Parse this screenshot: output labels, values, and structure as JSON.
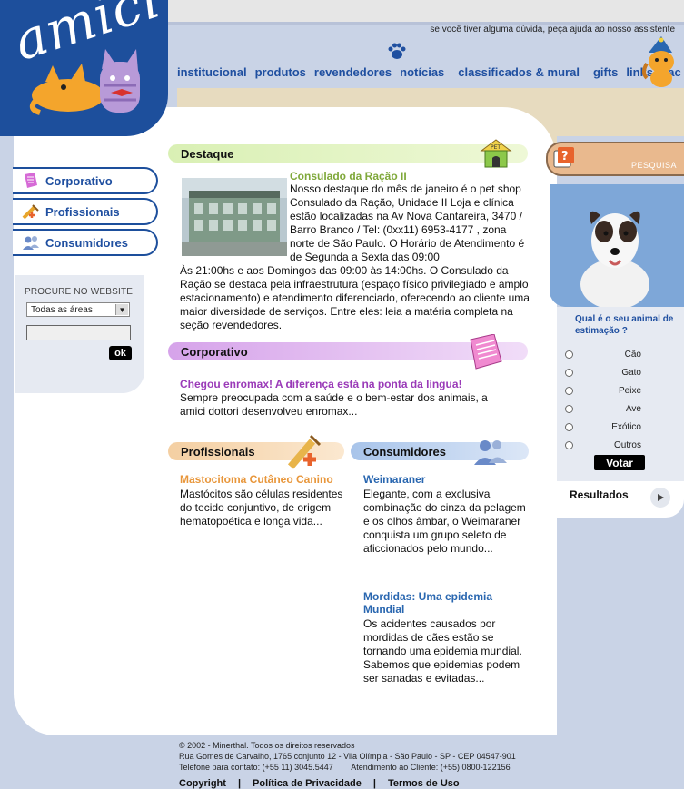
{
  "brand": {
    "logo": "amici"
  },
  "header": {
    "help_text": "se você tiver alguma dúvida, peça ajuda ao nosso assistente",
    "nav": [
      "institucional",
      "produtos",
      "revendedores",
      "notícias",
      "classificados & mural",
      "gifts",
      "links",
      "sac"
    ]
  },
  "sidebar": {
    "items": [
      {
        "label": "Corporativo",
        "icon": "document-icon"
      },
      {
        "label": "Profissionais",
        "icon": "syringe-icon"
      },
      {
        "label": "Consumidores",
        "icon": "people-icon"
      }
    ],
    "search_label": "PROCURE NO WEBSITE",
    "search_select": "Todas as áreas",
    "search_value": "",
    "ok_label": "ok"
  },
  "destaque": {
    "header": "Destaque",
    "title": "Consulado da Ração II",
    "text1": "Nosso destaque do mês de janeiro é o pet shop Consulado da Ração, Unidade II Loja e clínica estão localizadas na Av Nova Cantareira, 3470 / Barro Branco / Tel: (0xx11) 6953-4177 , zona norte de São Paulo. O Horário de Atendimento é de Segunda a Sexta das 09:00",
    "text2": "Às 21:00hs e aos Domingos das 09:00 às 14:00hs. O Consulado da Ração se destaca pela infraestrutura (espaço físico privilegiado e amplo estacionamento) e atendimento diferenciado, oferecendo ao cliente uma maior diversidade de serviços. Entre eles: leia a matéria completa na seção revendedores."
  },
  "corporativo": {
    "header": "Corporativo",
    "title": "Chegou enromax! A diferença está na ponta da língua!",
    "text": "Sempre preocupada com a saúde e o bem-estar dos animais, a amici dottori desenvolveu enromax..."
  },
  "profissionais": {
    "header": "Profissionais",
    "title": "Mastocitoma Cutâneo Canino",
    "text": "Mastócitos são células residentes do tecido conjuntivo, de origem hematopoética e longa vida..."
  },
  "consumidores": {
    "header": "Consumidores",
    "articles": [
      {
        "title": "Weimaraner",
        "text": "Elegante, com a exclusiva combinação do cinza da pelagem e os olhos âmbar, o Weimaraner conquista um grupo seleto de aficcionados pelo mundo..."
      },
      {
        "title": "Mordidas: Uma epidemia Mundial",
        "text": "Os acidentes causados por mordidas de cães estão se tornando uma epidemia mundial. Sabemos que epidemias podem ser sanadas e evitadas..."
      }
    ]
  },
  "pesquisa": {
    "label": "PESQUISA",
    "question": "Qual é o seu animal de estimação ?",
    "options": [
      "Cão",
      "Gato",
      "Peixe",
      "Ave",
      "Exótico",
      "Outros"
    ],
    "vote_label": "Votar",
    "results_label": "Resultados"
  },
  "footer": {
    "copyright": "© 2002 - Minerthal. Todos os direitos reservados",
    "address": "Rua Gomes de Carvalho, 1765 conjunto 12 - Vila Olímpia - São Paulo - SP - CEP 04547-901",
    "phone": "Telefone para contato: (+55 11) 3045.5447        Atendimento ao Cliente: (+55) 0800-122156",
    "links": [
      "Copyright",
      "Política de Privacidade",
      "Termos de Uso"
    ]
  },
  "colors": {
    "brand_blue": "#1d4f9c",
    "nav_blue": "#1f4fa0",
    "destaque_green": "#7fa83a",
    "corporativo_purple": "#9a3ab8",
    "profissionais_orange": "#e8963a",
    "consumidores_blue": "#2a67b0"
  }
}
